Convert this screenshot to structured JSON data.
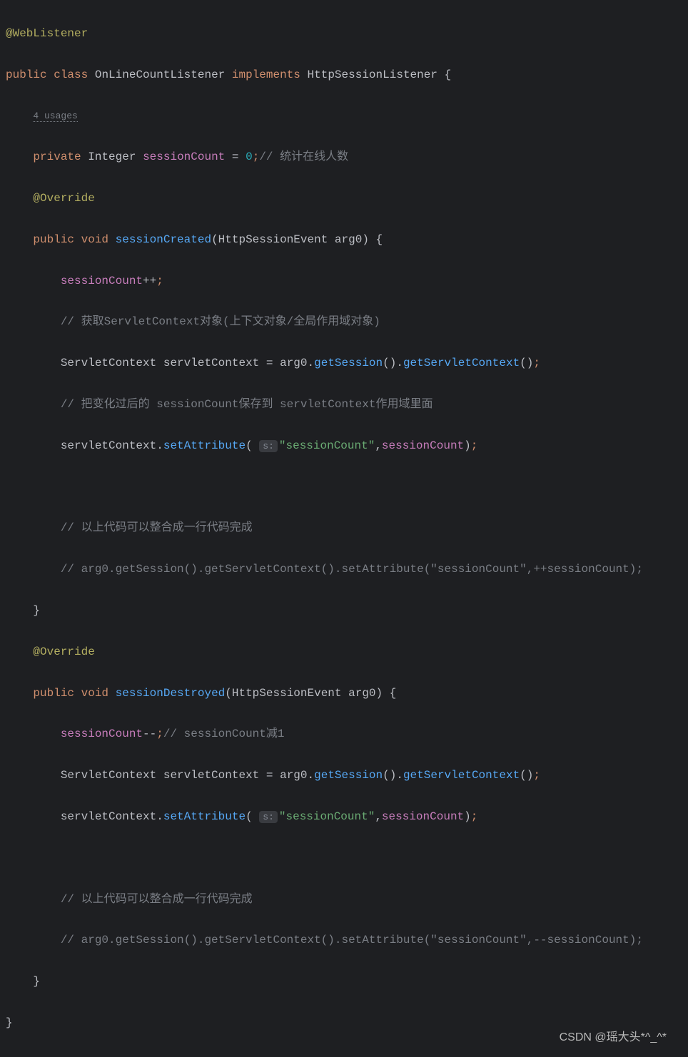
{
  "annotation": "@WebListener",
  "class_decl": {
    "public": "public",
    "class": "class",
    "name": "OnLineCountListener",
    "implements": "implements",
    "interface": "HttpSessionListener",
    "brace": "{"
  },
  "usage_hint": "4 usages",
  "field": {
    "private": "private",
    "type": "Integer",
    "name": "sessionCount",
    "eq": "=",
    "value": "0",
    "semi": ";",
    "comment": "// 统计在线人数"
  },
  "override1": "@Override",
  "method1": {
    "public": "public",
    "void": "void",
    "name": "sessionCreated",
    "lparen": "(",
    "param_type": "HttpSessionEvent",
    "param_name": "arg0",
    "rparen": ")",
    "brace": "{"
  },
  "m1_line1": {
    "field": "sessionCount",
    "op": "++",
    "semi": ";"
  },
  "m1_comment1": "// 获取ServletContext对象(上下文对象/全局作用域对象)",
  "m1_line2": {
    "type": "ServletContext",
    "var": "servletContext",
    "eq": "=",
    "arg": "arg0",
    "dot1": ".",
    "call1": "getSession",
    "p1": "()",
    "dot2": ".",
    "call2": "getServletContext",
    "p2": "()",
    "semi": ";"
  },
  "m1_comment2": "// 把变化过后的 sessionCount保存到 servletContext作用域里面",
  "m1_line3": {
    "var": "servletContext",
    "dot": ".",
    "call": "setAttribute",
    "lparen": "(",
    "hint": "s:",
    "str": "\"sessionCount\"",
    "comma": ",",
    "field": "sessionCount",
    "rparen": ")",
    "semi": ";"
  },
  "m1_comment3": "// 以上代码可以整合成一行代码完成",
  "m1_comment4": "// arg0.getSession().getServletContext().setAttribute(\"sessionCount\",++sessionCount);",
  "m1_close": "}",
  "override2": "@Override",
  "method2": {
    "public": "public",
    "void": "void",
    "name": "sessionDestroyed",
    "lparen": "(",
    "param_type": "HttpSessionEvent",
    "param_name": "arg0",
    "rparen": ")",
    "brace": "{"
  },
  "m2_line1": {
    "field": "sessionCount",
    "op": "--",
    "semi": ";",
    "comment": "// sessionCount减1"
  },
  "m2_line2": {
    "type": "ServletContext",
    "var": "servletContext",
    "eq": "=",
    "arg": "arg0",
    "dot1": ".",
    "call1": "getSession",
    "p1": "()",
    "dot2": ".",
    "call2": "getServletContext",
    "p2": "()",
    "semi": ";"
  },
  "m2_line3": {
    "var": "servletContext",
    "dot": ".",
    "call": "setAttribute",
    "lparen": "(",
    "hint": "s:",
    "str": "\"sessionCount\"",
    "comma": ",",
    "field": "sessionCount",
    "rparen": ")",
    "semi": ";"
  },
  "m2_comment3": "// 以上代码可以整合成一行代码完成",
  "m2_comment4": "// arg0.getSession().getServletContext().setAttribute(\"sessionCount\",--sessionCount);",
  "m2_close": "}",
  "class_close": "}",
  "watermark": "CSDN @瑶大头*^_^*"
}
